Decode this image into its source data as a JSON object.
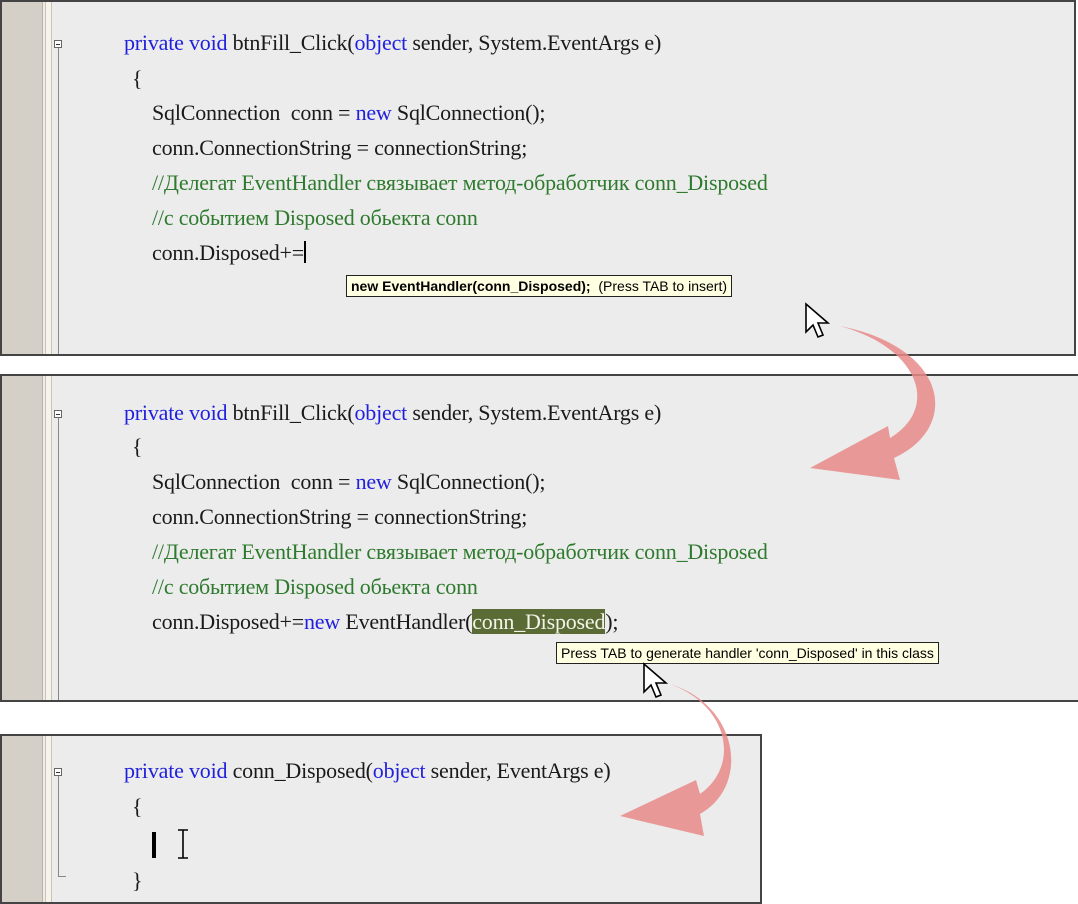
{
  "panels": [
    {
      "signature": {
        "kw1": "private",
        "kw2": "void",
        "rest1": " btnFill_Click(",
        "kw3": "object",
        "rest2": " sender, System.EventArgs e)"
      },
      "open_brace": "{",
      "line1": {
        "a": "SqlConnection  conn = ",
        "kw": "new",
        "b": " SqlConnection();"
      },
      "line2": "conn.ConnectionString = connectionString;",
      "comment1": "//Делегат EventHandler связывает метод-обработчик conn_Disposed",
      "comment2": "//с событием Disposed обьекта conn",
      "line3": "conn.Disposed+=",
      "tooltip": {
        "code": "new EventHandler(conn_Disposed);",
        "hint": "(Press TAB to insert)"
      }
    },
    {
      "signature": {
        "kw1": "private",
        "kw2": "void",
        "rest1": " btnFill_Click(",
        "kw3": "object",
        "rest2": " sender, System.EventArgs e)"
      },
      "open_brace": "{",
      "line1": {
        "a": "SqlConnection  conn = ",
        "kw": "new",
        "b": " SqlConnection();"
      },
      "line2": "conn.ConnectionString = connectionString;",
      "comment1": "//Делегат EventHandler связывает метод-обработчик conn_Disposed",
      "comment2": "//с событием Disposed обьекта conn",
      "line3": {
        "a": "conn.Disposed+=",
        "kw": "new",
        "b": " EventHandler(",
        "hl": "conn_Disposed",
        "c": ");"
      },
      "tooltip": "Press TAB to generate handler 'conn_Disposed' in this class"
    },
    {
      "signature": {
        "kw1": "private",
        "kw2": "void",
        "rest1": " conn_Disposed(",
        "kw3": "object",
        "rest2": " sender, EventArgs e)"
      },
      "open_brace": "{",
      "close_brace": "}"
    }
  ],
  "icons": [
    "mouse-pointer-icon",
    "i-beam-cursor-icon",
    "curved-arrow-icon"
  ],
  "colors": {
    "keyword": "#1f1fdd",
    "comment": "#2e7a2e",
    "highlight": "#5a6b36",
    "tooltip_bg": "#ffffe1",
    "arrow": "#e98a8a"
  }
}
